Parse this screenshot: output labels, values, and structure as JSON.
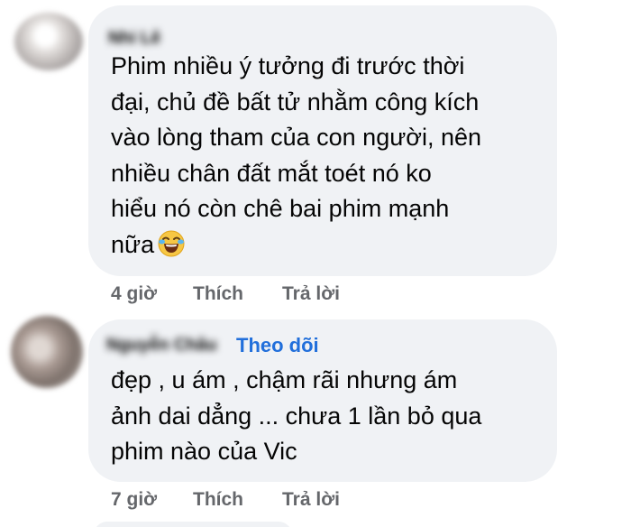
{
  "comments": [
    {
      "author": "Nhi Lê",
      "text": "Phim nhiều ý tưởng đi trước thời\nđại, chủ đề bất tử nhằm công kích\nvào lòng tham của con người, nên\nnhiều chân đất mắt toét nó ko\nhiểu nó còn chê bai phim mạnh\nnữa",
      "emoji": "laughing-tears",
      "time": "4 giờ",
      "like_label": "Thích",
      "reply_label": "Trả lời"
    },
    {
      "author": "Nguyễn Châu",
      "follow_label": "Theo dõi",
      "text": "đẹp , u ám , chậm rãi nhưng ám\nảnh dai dẳng ... chưa 1 lần bỏ qua\nphim nào của Vic",
      "time": "7 giờ",
      "like_label": "Thích",
      "reply_label": "Trả lời"
    }
  ],
  "colors": {
    "bubble": "#f0f2f5",
    "text": "#050505",
    "meta": "#65676b",
    "link": "#216fdb"
  }
}
